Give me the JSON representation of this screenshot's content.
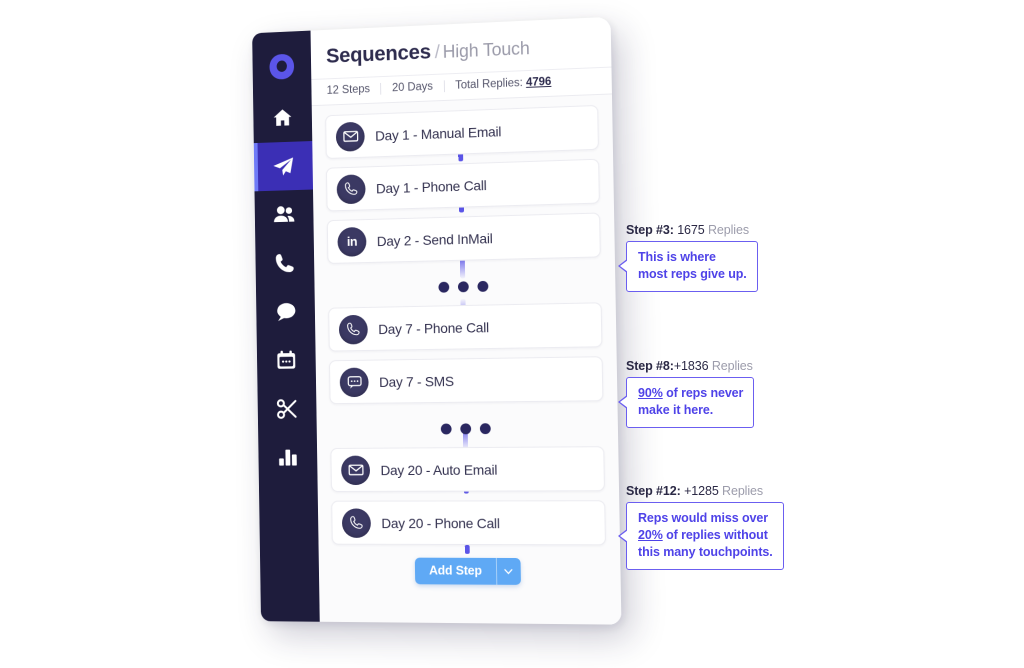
{
  "sidebar": {
    "logo_icon": "blob-logo-icon",
    "items": [
      {
        "icon": "home-icon",
        "name": "home",
        "active": false
      },
      {
        "icon": "paper-plane-icon",
        "name": "sequences",
        "active": true
      },
      {
        "icon": "people-icon",
        "name": "contacts",
        "active": false
      },
      {
        "icon": "phone-icon",
        "name": "calls",
        "active": false
      },
      {
        "icon": "chat-icon",
        "name": "messages",
        "active": false
      },
      {
        "icon": "calendar-icon",
        "name": "calendar",
        "active": false
      },
      {
        "icon": "scissors-icon",
        "name": "snippets",
        "active": false
      },
      {
        "icon": "bar-chart-icon",
        "name": "reports",
        "active": false
      }
    ]
  },
  "header": {
    "title": "Sequences",
    "separator": "/",
    "subtitle": "High Touch"
  },
  "stats": {
    "steps": "12 Steps",
    "days": "20 Days",
    "replies_label": "Total Replies:",
    "replies_value": "4796"
  },
  "steps": [
    {
      "icon": "envelope-icon",
      "label": "Day 1 - Manual Email"
    },
    {
      "icon": "phone-icon",
      "label": "Day 1 - Phone Call"
    },
    {
      "icon": "linkedin-icon",
      "label": "Day 2 - Send InMail",
      "badge_text": "in"
    },
    {
      "icon": "phone-icon",
      "label": "Day 7 - Phone Call"
    },
    {
      "icon": "sms-icon",
      "label": "Day 7 - SMS"
    },
    {
      "icon": "envelope-icon",
      "label": "Day 20 - Auto Email"
    },
    {
      "icon": "phone-icon",
      "label": "Day 20 - Phone Call"
    }
  ],
  "add_step": {
    "label": "Add Step",
    "caret_icon": "chevron-down-icon"
  },
  "annotations": [
    {
      "step": "Step #3:",
      "count": "1675",
      "replies_word": "Replies",
      "line1_pre": "",
      "line1_underlined": "",
      "line1_post": "This is where",
      "line2": "most reps give up.",
      "line3": ""
    },
    {
      "step": "Step #8:",
      "count": "+1836",
      "replies_word": "Replies",
      "line1_pre": "",
      "line1_underlined": "90%",
      "line1_post": " of reps never",
      "line2": "make it here.",
      "line3": ""
    },
    {
      "step": "Step #12:",
      "count": "+1285",
      "replies_word": "Replies",
      "line1_pre": "",
      "line1_underlined": "",
      "line1_post": "Reps would miss over",
      "line2_underlined": "20%",
      "line2_post": " of replies without",
      "line3": "this many touchpoints."
    }
  ],
  "colors": {
    "sidebar_bg": "#1e1c3c",
    "active_nav": "#3b2fb5",
    "active_accent": "#6f7bf7",
    "connector": "#5b55e8",
    "annotation": "#4f43e8",
    "add_step_button": "#5fa9f5",
    "badge": "#3b3963"
  }
}
